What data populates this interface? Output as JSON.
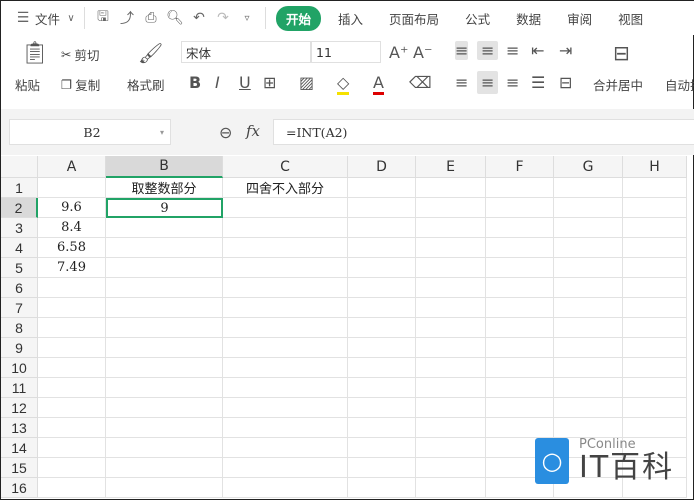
{
  "menu": {
    "file": "文件",
    "tabs": [
      "开始",
      "插入",
      "页面布局",
      "公式",
      "数据",
      "审阅",
      "视图"
    ]
  },
  "ribbon": {
    "paste": "粘贴",
    "cut": "剪切",
    "copy": "复制",
    "format_painter": "格式刷",
    "font": "宋体",
    "size": "11",
    "merge": "合并居中",
    "autowrap": "自动换"
  },
  "formula": {
    "name_box": "B2",
    "fx": "fx",
    "value": "=INT(A2)"
  },
  "columns": [
    "A",
    "B",
    "C",
    "D",
    "E",
    "F",
    "G",
    "H"
  ],
  "rows": [
    "1",
    "2",
    "3",
    "4",
    "5",
    "6",
    "7",
    "8",
    "9",
    "10",
    "11",
    "12",
    "13",
    "14",
    "15",
    "16"
  ],
  "cells": {
    "B1": "取整数部分",
    "C1": "四舍不入部分",
    "A2": "9.6",
    "B2": "9",
    "A3": "8.4",
    "A4": "6.58",
    "A5": "7.49"
  },
  "watermark": {
    "brand": "PConline",
    "name": "IT百科"
  },
  "colors": {
    "accent": "#21a366"
  }
}
